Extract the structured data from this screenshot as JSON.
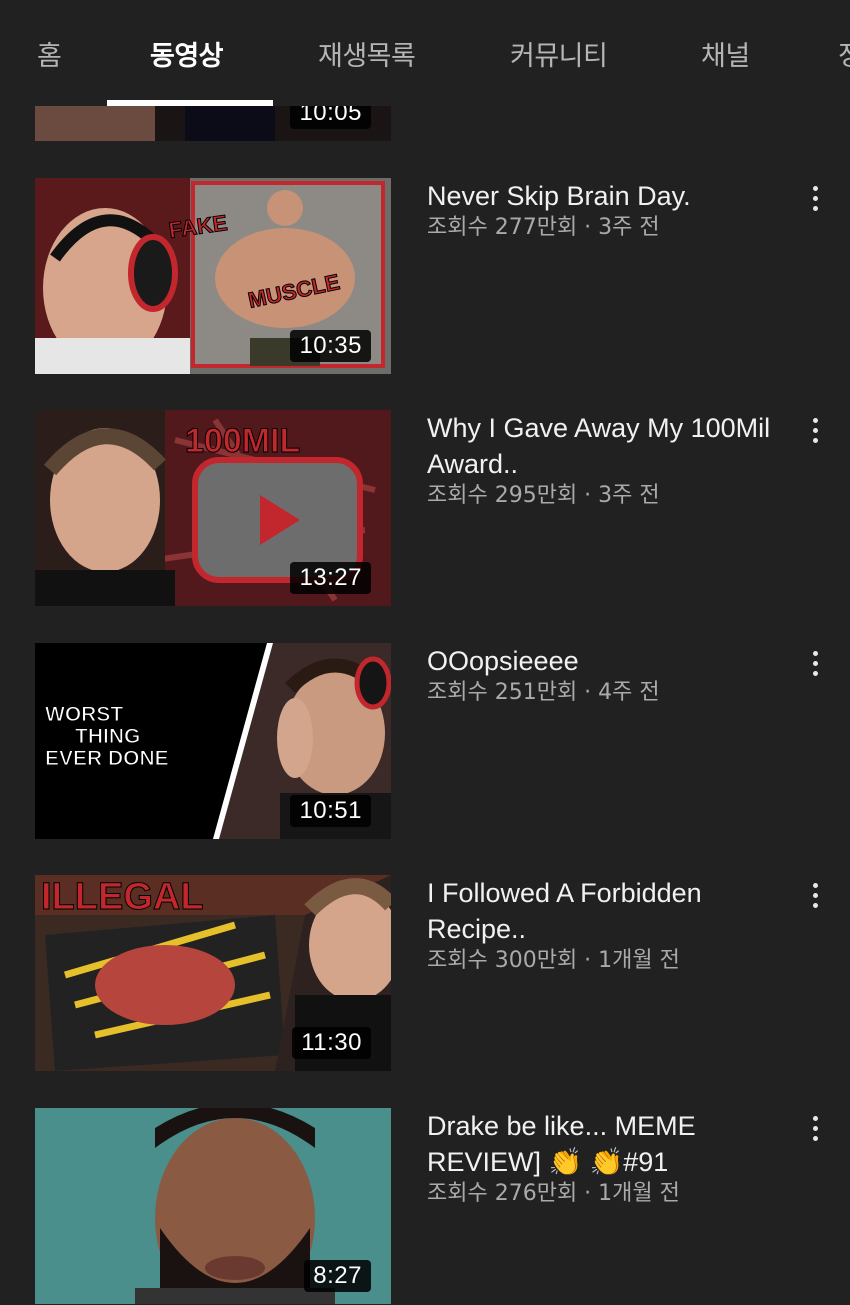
{
  "tabs": [
    {
      "label": "홈"
    },
    {
      "label": "동영상"
    },
    {
      "label": "재생목록"
    },
    {
      "label": "커뮤니티"
    },
    {
      "label": "채널"
    },
    {
      "label": "정"
    }
  ],
  "active_tab": "동영상",
  "partial_video": {
    "duration": "10:05"
  },
  "videos": [
    {
      "title": "Never Skip Brain Day.",
      "meta": "조회수 277만회 · 3주 전",
      "duration": "10:35",
      "thumb_text": [
        "FAKE",
        "MUSCLE"
      ]
    },
    {
      "title": "Why I Gave Away My 100Mil Award..",
      "meta": "조회수 295만회 · 3주 전",
      "duration": "13:27",
      "thumb_text": [
        "100MIL"
      ]
    },
    {
      "title": "OOopsieeee",
      "meta": "조회수 251만회 · 4주 전",
      "duration": "10:51",
      "thumb_text": [
        "WORST",
        "THING",
        "EVER DONE"
      ]
    },
    {
      "title": "I Followed A Forbidden Recipe..",
      "meta": "조회수 300만회 · 1개월 전",
      "duration": "11:30",
      "thumb_text": [
        "ILLEGAL"
      ]
    },
    {
      "title": "Drake be like... MEME REVIEW] 👏 👏#91",
      "meta": "조회수 276만회 · 1개월 전",
      "duration": "8:27",
      "thumb_text": []
    }
  ]
}
